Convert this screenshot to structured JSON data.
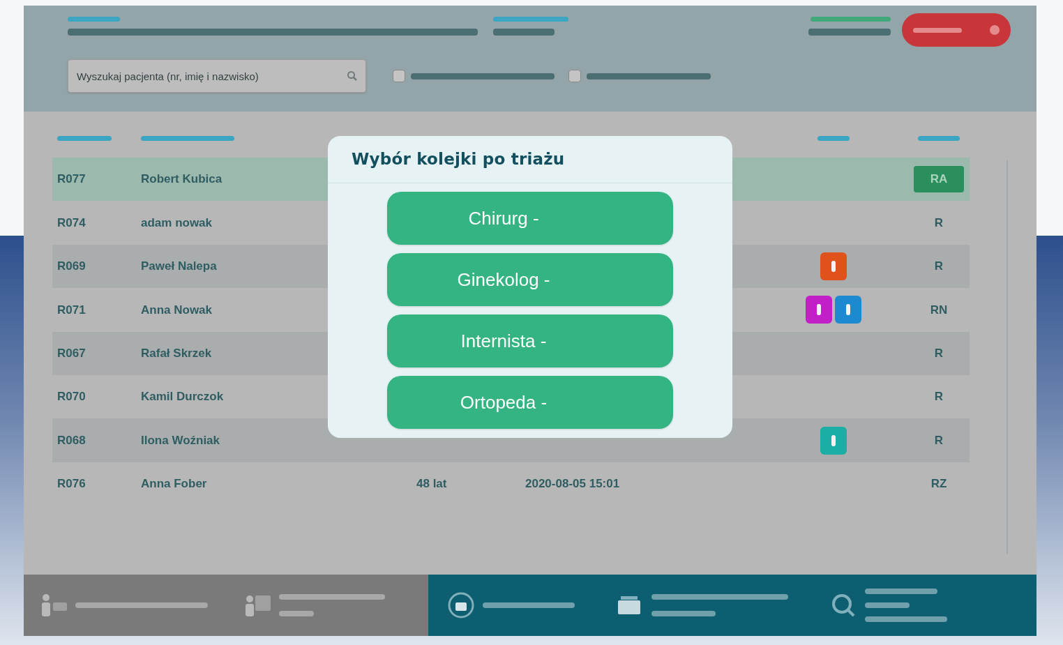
{
  "search": {
    "placeholder": "Wyszukaj pacjenta (nr, imię i nazwisko)"
  },
  "filters": [
    {
      "checked": false
    },
    {
      "checked": false
    }
  ],
  "patients": [
    {
      "kind": "badge",
      "number": "R077",
      "name": "Robert Kubica",
      "status": "RA",
      "highlighted": true
    },
    {
      "kind": "plain",
      "number": "R074",
      "name": "adam nowak",
      "status": "R",
      "highlighted": false
    },
    {
      "kind": "plain",
      "number": "R069",
      "name": "Paweł Nalepa",
      "flags": [
        {
          "color": "#e0521b"
        }
      ],
      "status": "R",
      "highlighted": false
    },
    {
      "kind": "plain",
      "number": "R071",
      "name": "Anna Nowak",
      "flags": [
        {
          "color": "#c21fc9"
        },
        {
          "color": "#1d8ad0"
        }
      ],
      "status": "RN",
      "highlighted": false
    },
    {
      "kind": "plain",
      "number": "R067",
      "name": "Rafał Skrzek",
      "status": "R",
      "highlighted": false
    },
    {
      "kind": "plain",
      "number": "R070",
      "name": "Kamil Durczok",
      "status": "R",
      "highlighted": false
    },
    {
      "kind": "plain",
      "number": "R068",
      "name": "Ilona Woźniak",
      "flags": [
        {
          "color": "#1aaea5"
        }
      ],
      "status": "R",
      "highlighted": false
    },
    {
      "kind": "plain",
      "number": "R076",
      "name": "Anna Fober",
      "age": "48 lat",
      "registered": "2020-08-05 15:01",
      "status": "RZ",
      "highlighted": false
    }
  ],
  "dialog": {
    "title": "Wybór kolejki po triażu",
    "options": [
      "Chirurg -",
      "Ginekolog -",
      "Internista -",
      "Ortopeda -"
    ]
  }
}
